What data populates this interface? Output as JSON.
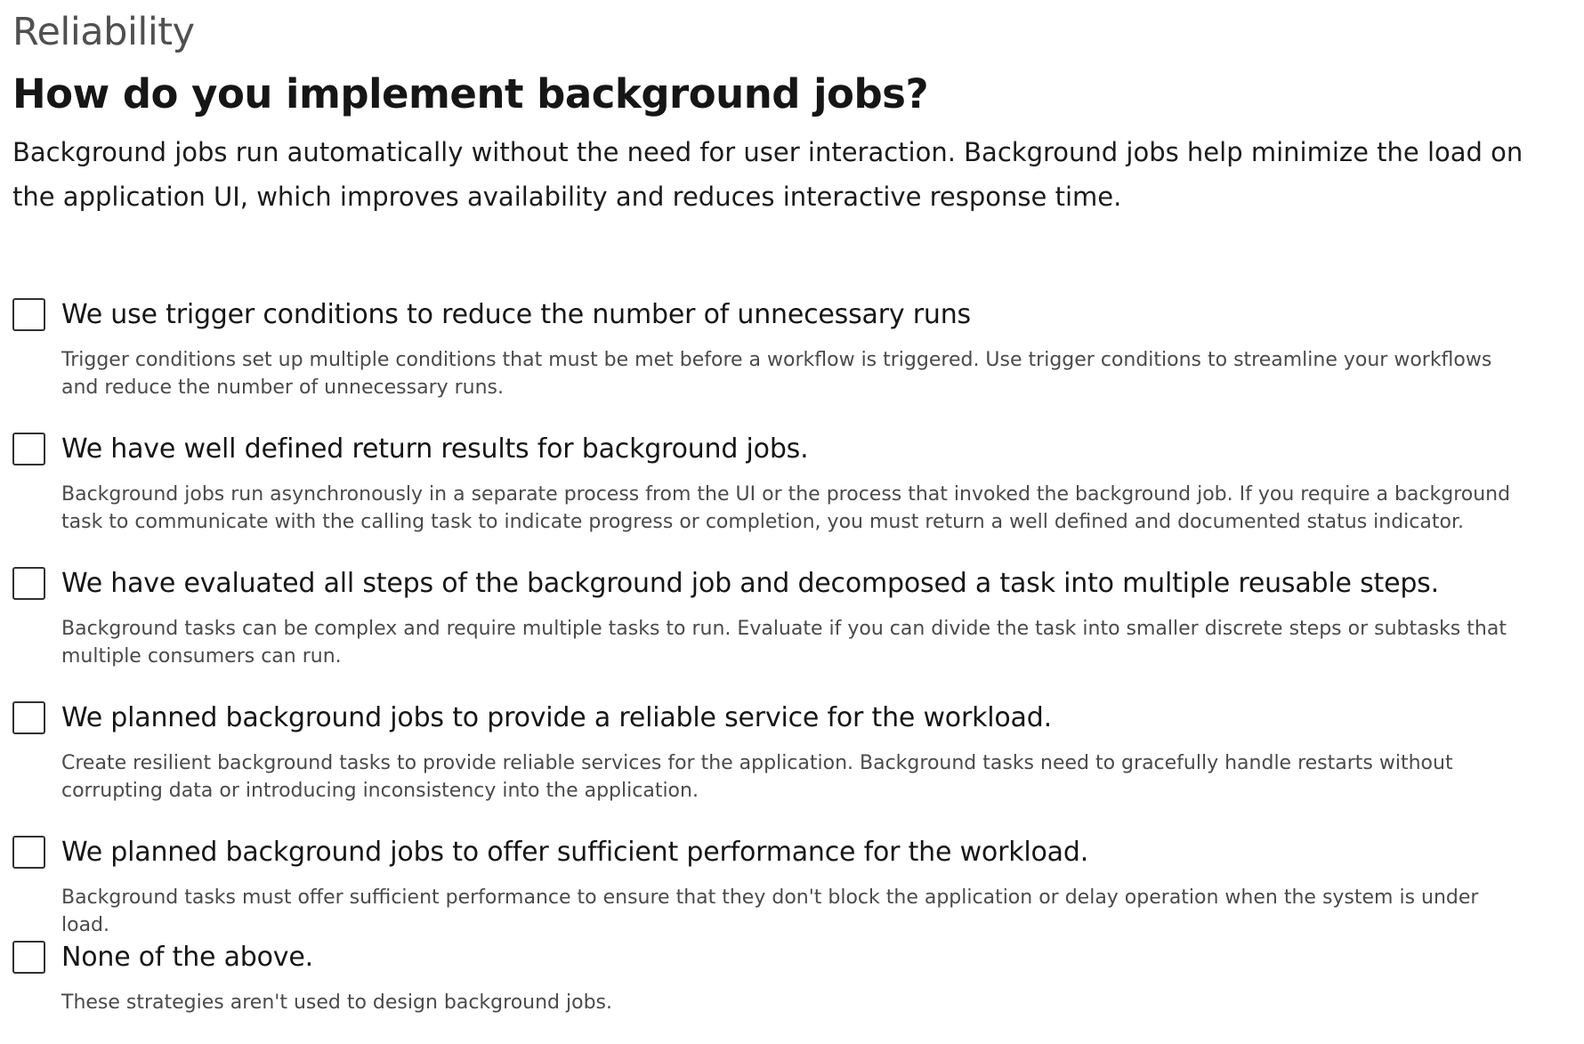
{
  "header": {
    "pillar": "Reliability",
    "question": "How do you implement background jobs?",
    "intro": "Background jobs run automatically without the need for user interaction. Background jobs help minimize the load on the application UI, which improves availability and reduces interactive response time."
  },
  "options": [
    {
      "label": "We use trigger conditions to reduce the number of unnecessary runs",
      "description": "Trigger conditions set up multiple conditions that must be met before a workflow is triggered. Use trigger conditions to streamline your workflows and reduce the number of unnecessary runs.",
      "checked": false
    },
    {
      "label": "We have well defined return results for background jobs.",
      "description": "Background jobs run asynchronously in a separate process from the UI or the process that invoked the background job. If you require a background task to communicate with the calling task to indicate progress or completion, you must return a well defined and documented status indicator.",
      "checked": false
    },
    {
      "label": "We have evaluated all steps of the background job and decomposed a task into multiple reusable steps.",
      "description": "Background tasks can be complex and require multiple tasks to run. Evaluate if you can divide the task into smaller discrete steps or subtasks that multiple consumers can run.",
      "checked": false
    },
    {
      "label": "We planned background jobs to provide a reliable service for the workload.",
      "description": "Create resilient background tasks to provide reliable services for the application. Background tasks need to gracefully handle restarts without corrupting data or introducing inconsistency into the application.",
      "checked": false
    },
    {
      "label": "We planned background jobs to offer sufficient performance for the workload.",
      "description": "Background tasks must offer sufficient performance to ensure that they don't block the application or delay operation when the system is under load.",
      "checked": false
    },
    {
      "label": "None of the above.",
      "description": "These strategies aren't used to design background jobs.",
      "checked": false
    }
  ]
}
